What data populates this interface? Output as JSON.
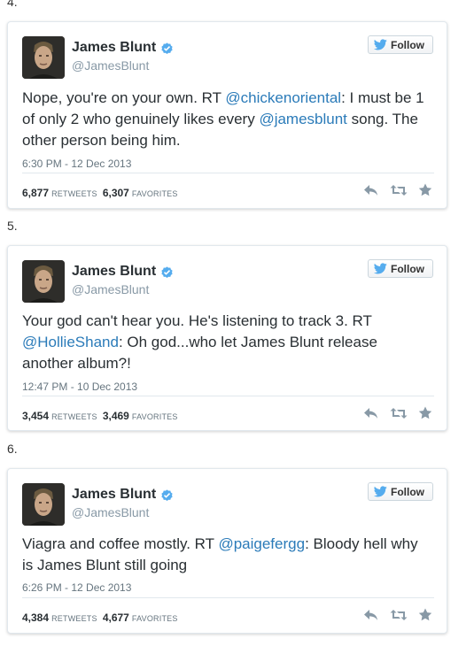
{
  "colors": {
    "link": "#2b7bb9",
    "verified": "#55acee",
    "twitter_bird": "#55acee",
    "icon_gray": "#8899a6"
  },
  "tweets": [
    {
      "number": "4.",
      "name": "James Blunt",
      "handle": "@JamesBlunt",
      "follow_label": "Follow",
      "text_parts": [
        {
          "type": "text",
          "value": "Nope, you're on your own. RT "
        },
        {
          "type": "mention",
          "value": "@chickenoriental"
        },
        {
          "type": "text",
          "value": ": I must be 1 of only 2 who genuinely likes every "
        },
        {
          "type": "mention",
          "value": "@jamesblunt"
        },
        {
          "type": "text",
          "value": " song. The other person being him."
        }
      ],
      "timestamp": "6:30 PM - 12 Dec 2013",
      "retweets": "6,877",
      "retweets_label": "RETWEETS",
      "favorites": "6,307",
      "favorites_label": "FAVORITES",
      "icons": [
        "reply-icon",
        "retweet-icon",
        "favorite-icon"
      ]
    },
    {
      "number": "5.",
      "name": "James Blunt",
      "handle": "@JamesBlunt",
      "follow_label": "Follow",
      "text_parts": [
        {
          "type": "text",
          "value": "Your god can't hear you. He's listening to track 3. RT "
        },
        {
          "type": "mention",
          "value": "@HollieShand"
        },
        {
          "type": "text",
          "value": ": Oh god...who let James Blunt release another album?!"
        }
      ],
      "timestamp": "12:47 PM - 10 Dec 2013",
      "retweets": "3,454",
      "retweets_label": "RETWEETS",
      "favorites": "3,469",
      "favorites_label": "FAVORITES",
      "icons": [
        "reply-icon",
        "retweet-icon",
        "favorite-icon"
      ]
    },
    {
      "number": "6.",
      "name": "James Blunt",
      "handle": "@JamesBlunt",
      "follow_label": "Follow",
      "text_parts": [
        {
          "type": "text",
          "value": "Viagra and coffee mostly. RT "
        },
        {
          "type": "mention",
          "value": "@paigefergg"
        },
        {
          "type": "text",
          "value": ": Bloody hell why is James Blunt still going"
        }
      ],
      "timestamp": "6:26 PM - 12 Dec 2013",
      "retweets": "4,384",
      "retweets_label": "RETWEETS",
      "favorites": "4,677",
      "favorites_label": "FAVORITES",
      "icons": [
        "reply-icon",
        "retweet-icon",
        "favorite-icon"
      ]
    }
  ]
}
